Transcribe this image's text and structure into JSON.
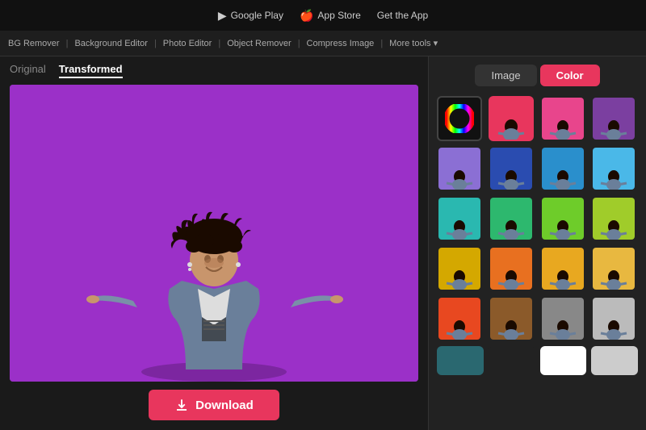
{
  "topBar": {
    "items": [
      {
        "label": "Google Play",
        "icon": "▶"
      },
      {
        "label": "App Store",
        "icon": ""
      },
      {
        "label": "Get the App",
        "icon": ""
      }
    ]
  },
  "subNav": {
    "items": [
      "BG Remover",
      "Background Editor",
      "Photo Editor",
      "Object Remover",
      "Compress Image",
      "More tools ▾"
    ]
  },
  "tabs": {
    "original": "Original",
    "transformed": "Transformed",
    "activeTab": "transformed"
  },
  "rightPanel": {
    "imageLabel": "Image",
    "colorLabel": "Color",
    "activeToggle": "color"
  },
  "colorSwatches": [
    {
      "id": "wheel",
      "type": "wheel"
    },
    {
      "id": "red",
      "bg": "#e8365d",
      "type": "person"
    },
    {
      "id": "pink",
      "bg": "#e8458c",
      "type": "person"
    },
    {
      "id": "purple-dark",
      "bg": "#7b3fa0",
      "type": "person"
    },
    {
      "id": "lavender",
      "bg": "#8b6fd4",
      "type": "person"
    },
    {
      "id": "blue-dark",
      "bg": "#2a4cb0",
      "type": "person"
    },
    {
      "id": "cyan-blue",
      "bg": "#2a8fcc",
      "type": "person"
    },
    {
      "id": "light-blue",
      "bg": "#4ab8e8",
      "type": "person"
    },
    {
      "id": "teal",
      "bg": "#2ab8b0",
      "type": "person"
    },
    {
      "id": "green",
      "bg": "#2db86e",
      "type": "person"
    },
    {
      "id": "lime-green",
      "bg": "#6ecc2a",
      "type": "person"
    },
    {
      "id": "yellow-green",
      "bg": "#a0cc2a",
      "type": "person"
    },
    {
      "id": "gold",
      "bg": "#d4a800",
      "type": "person"
    },
    {
      "id": "orange",
      "bg": "#e87020",
      "type": "person"
    },
    {
      "id": "amber",
      "bg": "#e8a820",
      "type": "person"
    },
    {
      "id": "orange-yellow",
      "bg": "#e8b840",
      "type": "person"
    },
    {
      "id": "orange-red",
      "bg": "#e84820",
      "type": "person"
    },
    {
      "id": "brown",
      "bg": "#8b5a2a",
      "type": "person"
    },
    {
      "id": "gray",
      "bg": "#888888",
      "type": "person"
    },
    {
      "id": "light-gray",
      "bg": "#bbbbbb",
      "type": "person"
    }
  ],
  "partialSwatches": [
    {
      "id": "partial-dark-teal",
      "bg": "#2a6870"
    },
    {
      "id": "partial-dark",
      "bg": "#222222"
    },
    {
      "id": "partial-white",
      "bg": "#ffffff"
    },
    {
      "id": "partial-extra",
      "bg": "#cccccc"
    }
  ],
  "downloadButton": {
    "label": "Download"
  },
  "currentBgColor": "#9b30c8"
}
